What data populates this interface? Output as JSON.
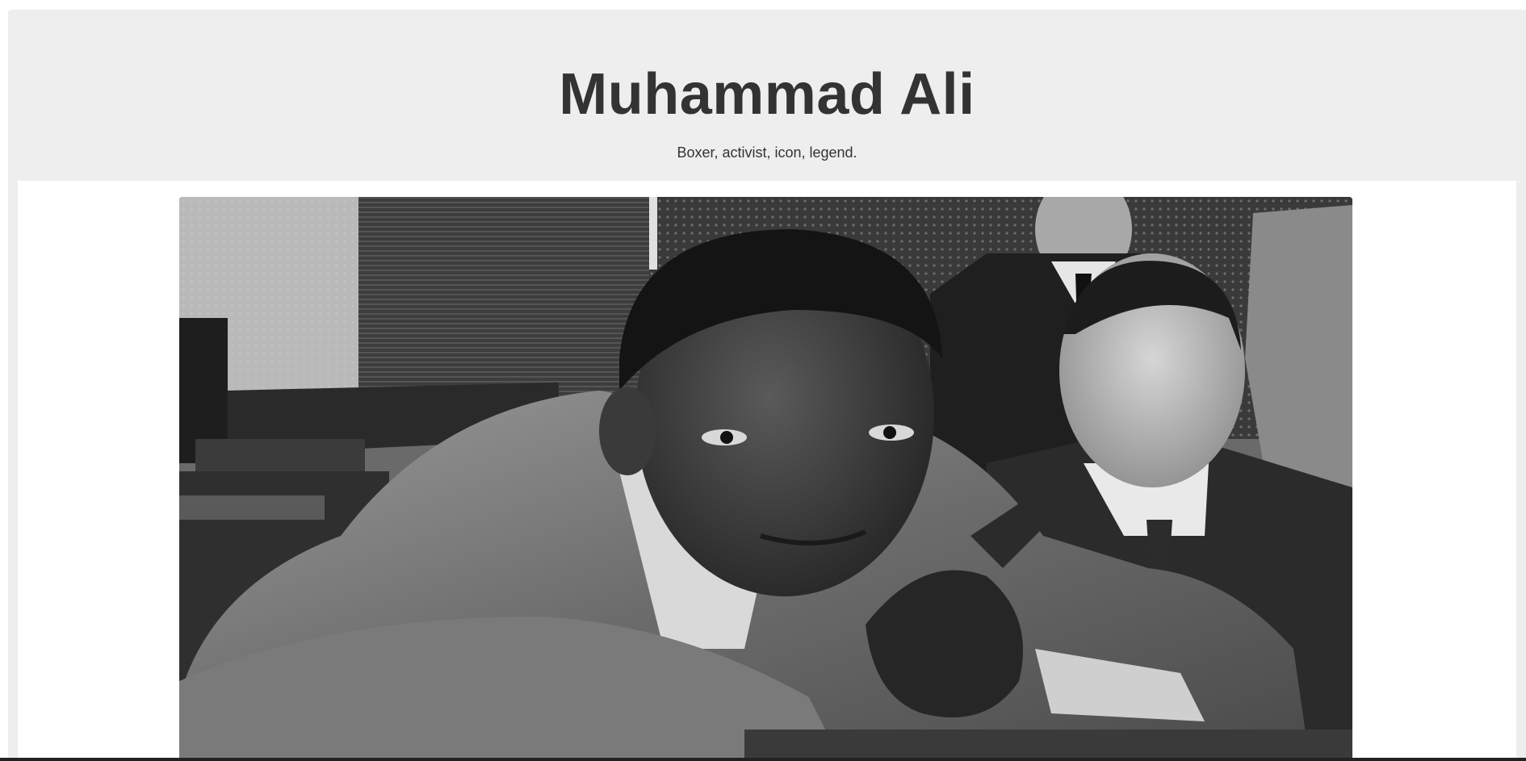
{
  "header": {
    "title": "Muhammad Ali",
    "subtitle": "Boxer, activist, icon, legend."
  },
  "image": {
    "description_alt": "",
    "style": "black-and-white photograph"
  },
  "colors": {
    "page_background": "#eeeeee",
    "content_background": "#ffffff",
    "text": "#333333"
  }
}
